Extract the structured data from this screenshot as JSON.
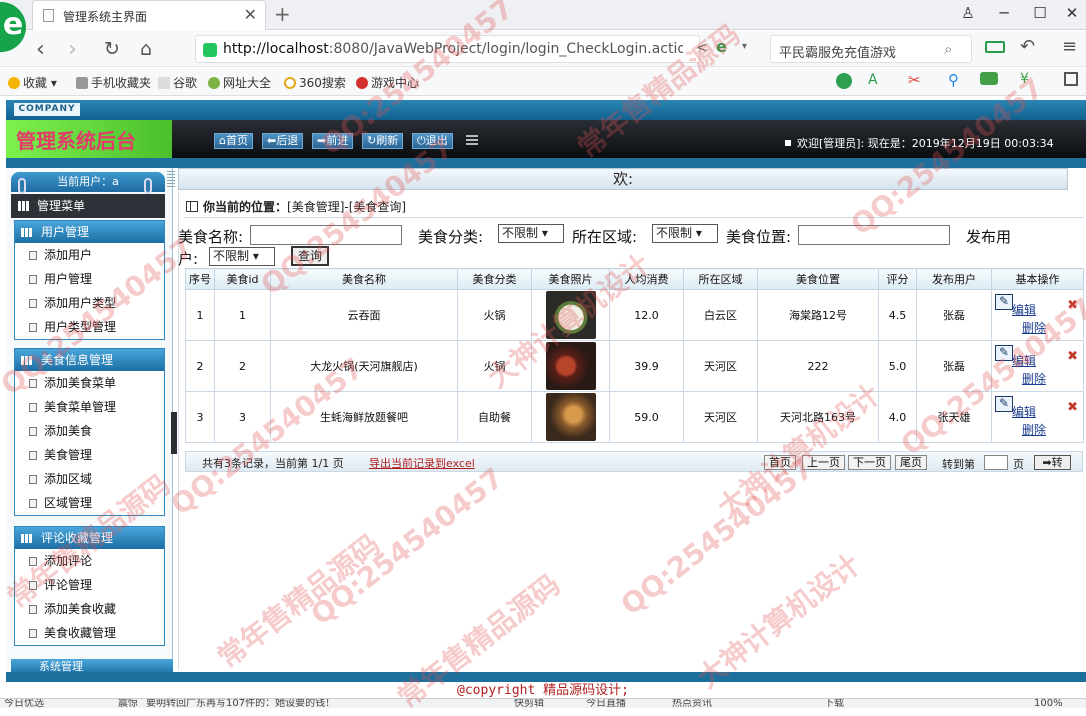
{
  "browser": {
    "tab_title": "管理系统主界面",
    "url_host": "http://localhost",
    "url_rest": ":8080/JavaWebProject/login/login_CheckLogin.action",
    "search_text": "平民霸服免充值游戏",
    "bookmarks": [
      "收藏",
      "手机收藏夹",
      "谷歌",
      "网址大全",
      "360搜索",
      "游戏中心"
    ]
  },
  "app": {
    "company_label": "COMPANY",
    "title": "管理系统后台",
    "top_buttons": [
      "首页",
      "后退",
      "前进",
      "刷新",
      "退出"
    ],
    "welcome": "欢迎[管理员]:   现在是：2019年12月19日 00:03:34",
    "current_user": "当前用户：a",
    "menu_title": "管理菜单",
    "menu_groups": [
      {
        "title": "用户管理",
        "items": [
          "添加用户",
          "用户管理",
          "添加用户类型",
          "用户类型管理"
        ]
      },
      {
        "title": "美食信息管理",
        "items": [
          "添加美食菜单",
          "美食菜单管理",
          "添加美食",
          "美食管理",
          "添加区域",
          "区域管理"
        ]
      },
      {
        "title": "评论收藏管理",
        "items": [
          "添加评论",
          "评论管理",
          "添加美食收藏",
          "美食收藏管理"
        ]
      }
    ],
    "system_menu": "系统管理",
    "welcome_bar": "欢:",
    "copyright": "@copyright 精品源码设计;"
  },
  "content": {
    "location_label": "你当前的位置：",
    "location_value": "[美食管理]-[美食查询]",
    "filters": {
      "name_label": "美食名称:",
      "category_label": "美食分类:",
      "category_value": "不限制",
      "area_label": "所在区域:",
      "area_value": "不限制",
      "position_label": "美食位置:",
      "publisher_label": "发布用",
      "publisher_label2": "户:",
      "publisher_value": "不限制",
      "query_button": "查询"
    },
    "table": {
      "headers": [
        "序号",
        "美食id",
        "美食名称",
        "美食分类",
        "美食照片",
        "人均消费",
        "所在区域",
        "美食位置",
        "评分",
        "发布用户",
        "基本操作"
      ],
      "rows": [
        {
          "no": "1",
          "id": "1",
          "name": "云吞面",
          "category": "火锅",
          "price": "12.0",
          "area": "白云区",
          "position": "海棠路12号",
          "score": "4.5",
          "user": "张磊"
        },
        {
          "no": "2",
          "id": "2",
          "name": "大龙火锅(天河旗舰店)",
          "category": "火锅",
          "price": "39.9",
          "area": "天河区",
          "position": "222",
          "score": "5.0",
          "user": "张磊"
        },
        {
          "no": "3",
          "id": "3",
          "name": "生蚝海鲜放题餐吧",
          "category": "自助餐",
          "price": "59.0",
          "area": "天河区",
          "position": "天河北路163号",
          "score": "4.0",
          "user": "张天雄"
        }
      ],
      "edit_label": "编辑",
      "delete_label": "删除"
    },
    "pager": {
      "info": "共有3条记录，当前第 1/1 页",
      "export": "导出当前记录到excel",
      "buttons": [
        "首页",
        "上一页",
        "下一页",
        "尾页"
      ],
      "jump_label": "转到第",
      "page_unit": "页",
      "go": "转"
    }
  },
  "statusbar": [
    "今日优选",
    "震惊",
    "要明转回广东再写107件的：她设要的钱！",
    "快剪辑",
    "今日直播",
    "热点资讯",
    "下载",
    "100%"
  ],
  "watermark": [
    "QQ:254540457",
    "大神计算机设计",
    "常年售精品源码"
  ],
  "colors": {
    "accent_blue": "#1c6ea4",
    "title_pink": "#e43a6b",
    "title_green": "#6ae044",
    "link_red": "#b21f1f"
  }
}
